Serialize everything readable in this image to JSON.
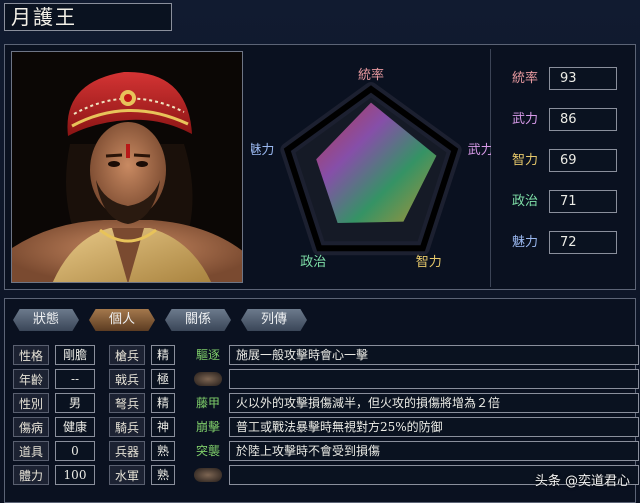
{
  "title": "月護王",
  "radar": {
    "labels": [
      "統率",
      "武力",
      "智力",
      "政治",
      "魅力"
    ],
    "values": [
      93,
      86,
      69,
      71,
      72
    ],
    "max": 100
  },
  "stats": [
    {
      "label": "統率",
      "value": "93",
      "color": "#e99aa0"
    },
    {
      "label": "武力",
      "value": "86",
      "color": "#d79ae8"
    },
    {
      "label": "智力",
      "value": "69",
      "color": "#e6c86a"
    },
    {
      "label": "政治",
      "value": "71",
      "color": "#7fe0a8"
    },
    {
      "label": "魅力",
      "value": "72",
      "color": "#9ab8f0"
    }
  ],
  "tabs": [
    "狀態",
    "個人",
    "關係",
    "列傳"
  ],
  "active_tab": 1,
  "personal": [
    {
      "label": "性格",
      "value": "剛膽"
    },
    {
      "label": "年齡",
      "value": "--"
    },
    {
      "label": "性別",
      "value": "男"
    },
    {
      "label": "傷病",
      "value": "健康"
    },
    {
      "label": "道具",
      "value": "0"
    },
    {
      "label": "體力",
      "value": "100"
    }
  ],
  "troops": [
    {
      "label": "槍兵",
      "value": "精"
    },
    {
      "label": "戟兵",
      "value": "極"
    },
    {
      "label": "弩兵",
      "value": "精"
    },
    {
      "label": "騎兵",
      "value": "神"
    },
    {
      "label": "兵器",
      "value": "熟"
    },
    {
      "label": "水軍",
      "value": "熟"
    }
  ],
  "skills": [
    {
      "name": "驅逐",
      "desc": "施展一般攻擊時會心一擊"
    },
    {
      "name": "",
      "desc": ""
    },
    {
      "name": "藤甲",
      "desc": "火以外的攻擊損傷減半，但火攻的損傷將增為２倍"
    },
    {
      "name": "崩擊",
      "desc": "普工或戰法暴擊時無視對方25%的防御"
    },
    {
      "name": "突襲",
      "desc": "於陸上攻擊時不會受到損傷"
    },
    {
      "name": "",
      "desc": ""
    }
  ],
  "watermark": "头条 @奕道君心"
}
